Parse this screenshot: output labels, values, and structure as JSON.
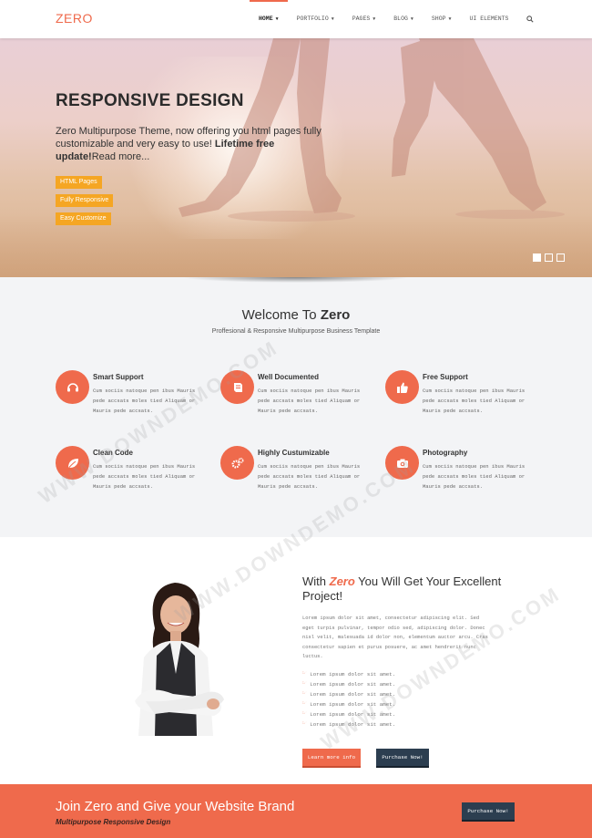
{
  "navbar": {
    "logo": "ZERO",
    "items": [
      {
        "label": "HOME",
        "has_caret": true
      },
      {
        "label": "PORTFOLIO",
        "has_caret": true
      },
      {
        "label": "PAGES",
        "has_caret": true
      },
      {
        "label": "BLOG",
        "has_caret": true
      },
      {
        "label": "SHOP",
        "has_caret": true
      },
      {
        "label": "UI ELEMENTS",
        "has_caret": false
      }
    ],
    "caret_glyph": "▼",
    "search_icon": "search-icon"
  },
  "hero": {
    "title": "RESPONSIVE DESIGN",
    "text_plain": "Zero Multipurpose Theme, now offering you html pages fully customizable and very easy to use! ",
    "text_bold": "Lifetime free update!",
    "text_tail": "Read more...",
    "tags": [
      "HTML Pages",
      "Fully Responsive",
      "Easy Customize"
    ],
    "tag_color": "#f5a623",
    "slides": 3,
    "active_slide": 1
  },
  "features": {
    "heading_prefix": "Welcome To ",
    "heading_brand": "Zero",
    "subheading": "Proffesional & Responsive Multipurpose Business Template",
    "items": [
      {
        "title": "Smart Support",
        "icon": "support-icon",
        "desc": "Cum sociis natoque pen ibus Mauris pede accsats moles tied Aliquam or Mauris pede accsats."
      },
      {
        "title": "Well Documented",
        "icon": "book-icon",
        "desc": "Cum sociis natoque pen ibus Mauris pede accsats moles tied Aliquam or Mauris pede accsats."
      },
      {
        "title": "Free Support",
        "icon": "thumbs-up-icon",
        "desc": "Cum sociis natoque pen ibus Mauris pede accsats moles tied Aliquam or Mauris pede accsats."
      },
      {
        "title": "Clean Code",
        "icon": "leaf-icon",
        "desc": "Cum sociis natoque pen ibus Mauris pede accsats moles tied Aliquam or Mauris pede accsats."
      },
      {
        "title": "Highly Custumizable",
        "icon": "gears-icon",
        "desc": "Cum sociis natoque pen ibus Mauris pede accsats moles tied Aliquam or Mauris pede accsats."
      },
      {
        "title": "Photography",
        "icon": "camera-icon",
        "desc": "Cum sociis natoque pen ibus Mauris pede accsats moles tied Aliquam or Mauris pede accsats."
      }
    ]
  },
  "promo": {
    "title_prefix": "With ",
    "title_brand": "Zero",
    "title_suffix": " You Will Get Your Excellent Project!",
    "paragraph": "Lorem ipsum dolor sit amet, consectetur adipiscing elit. Sed eget turpis pulvinar, tempor odio sed, adipiscing dolor. Donec nisl velit, malesuada id dolor non, elementum auctor arcu. Cras consectetur sapien et purus posuere, ac amet hendrerit nunc luctus.",
    "list": [
      "Lorem ipsum dolor sit amet.",
      "Lorem ipsum dolor sit amet.",
      "Lorem ipsum dolor sit amet.",
      "Lorem ipsum dolor sit amet.",
      "Lorem ipsum dolor sit amet.",
      "Lorem ipsum dolor sit amet."
    ],
    "list_icon": "thumbs-up-icon",
    "learn_more": "Learn more info",
    "purchase": "Purchase Now!"
  },
  "cta": {
    "title": "Join Zero and Give your Website Brand",
    "subtitle": "Multipurpose Responsive Design",
    "button": "Purchase Now!"
  },
  "watermark": "WWW.DOWNDEMO.COM",
  "colors": {
    "accent": "#ef6a4c",
    "dark": "#2c3e50",
    "tag": "#f5a623"
  }
}
